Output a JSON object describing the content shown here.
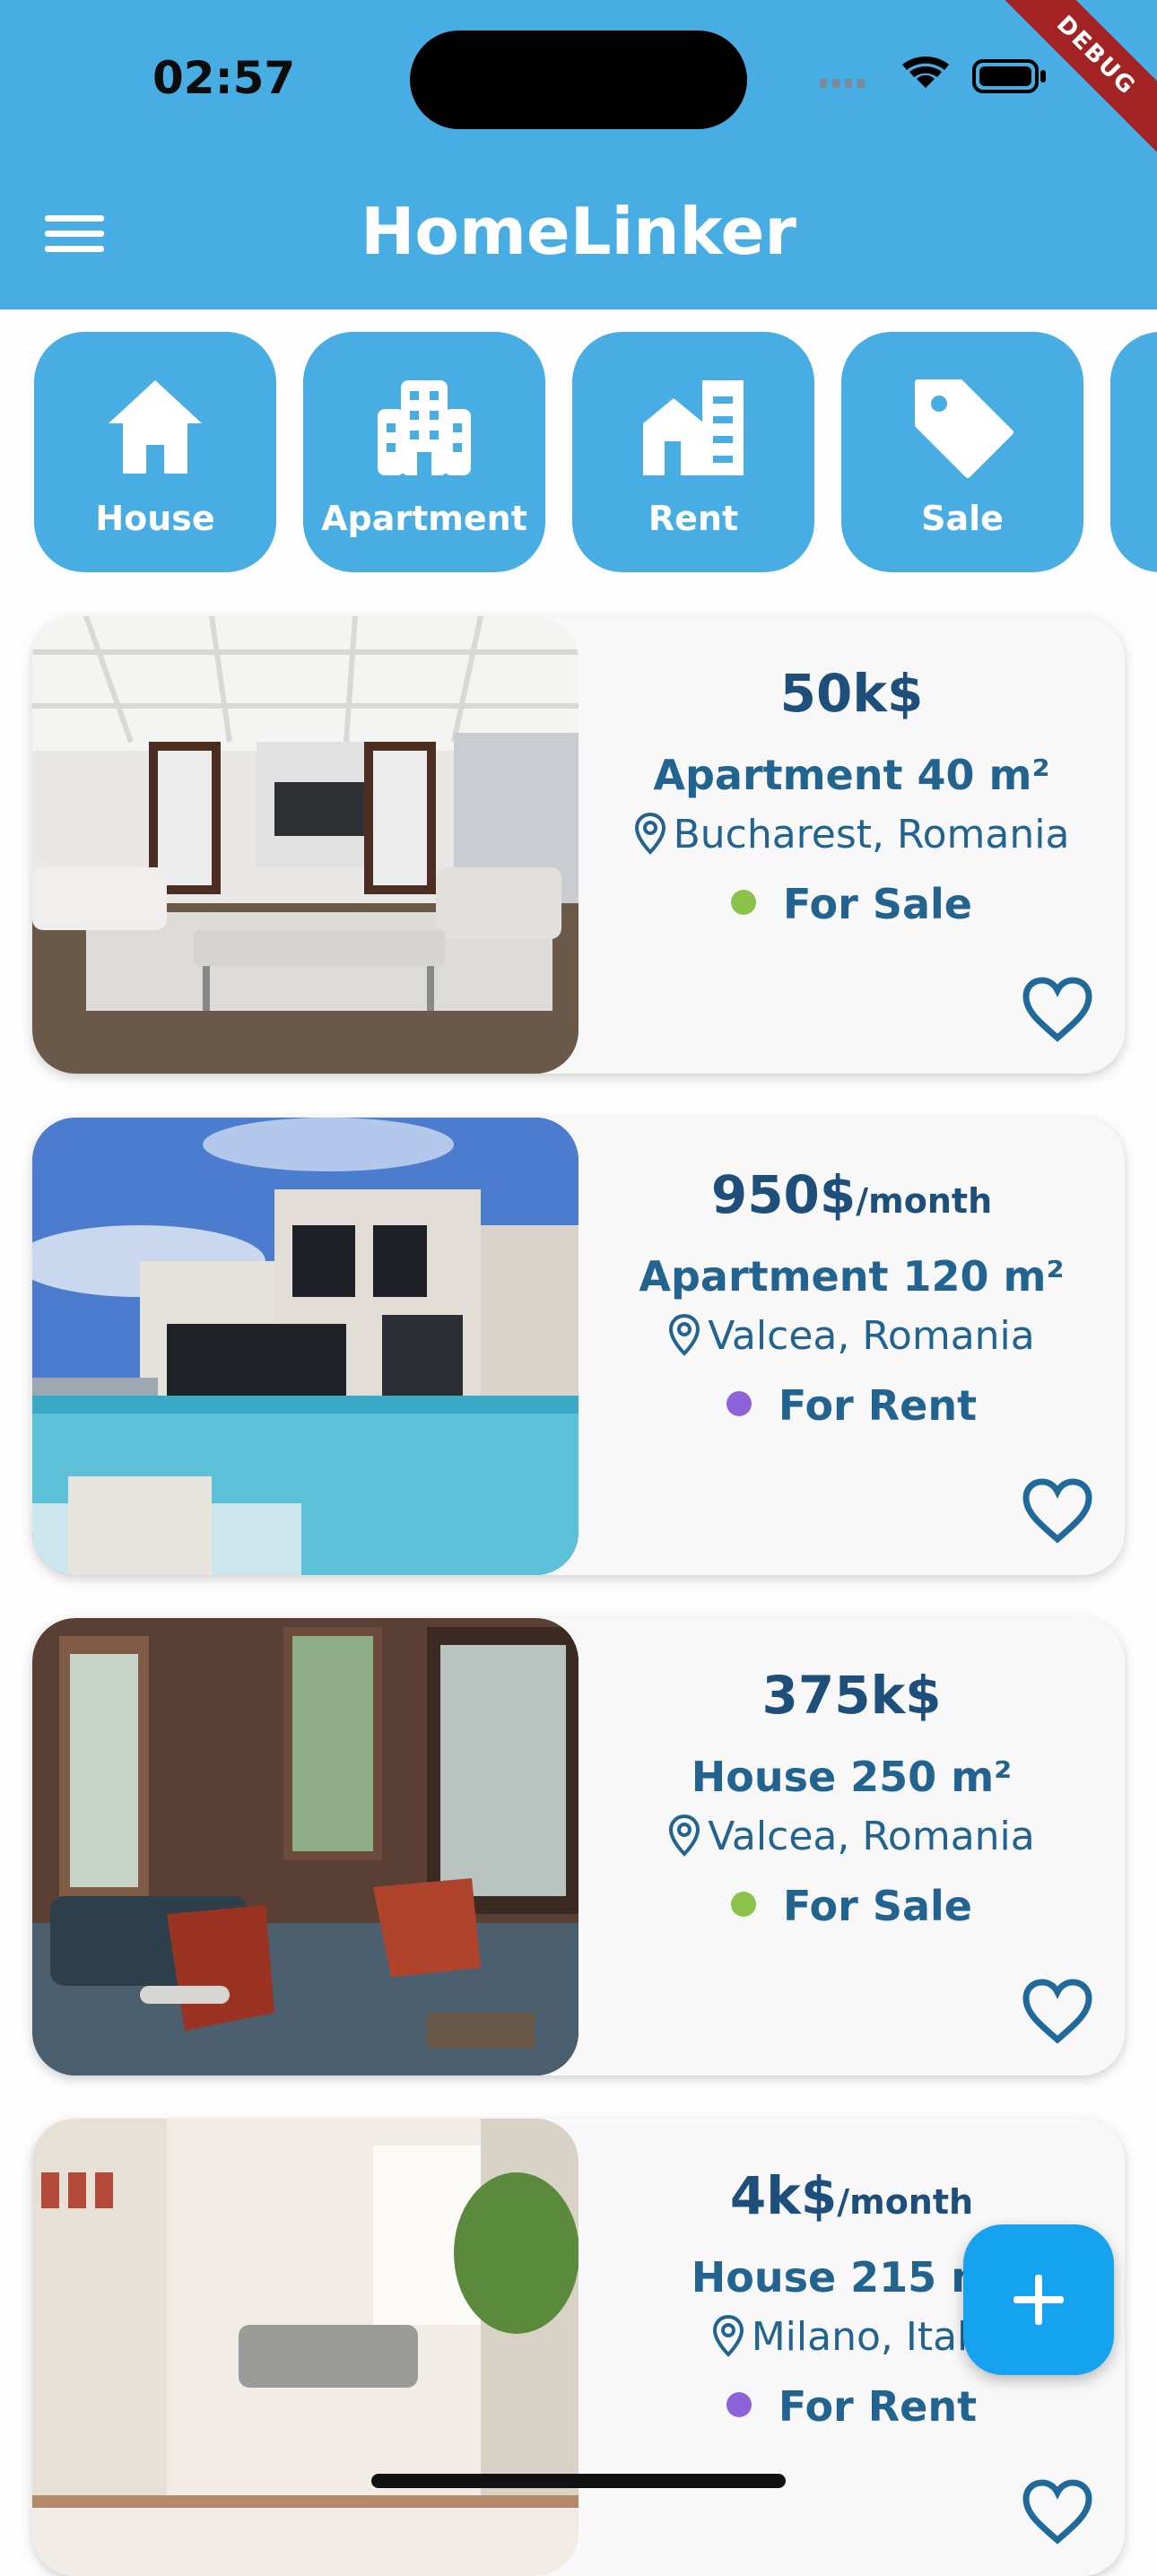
{
  "status_bar": {
    "time": "02:57"
  },
  "debug_banner": "DEBUG",
  "app": {
    "title": "HomeLinker"
  },
  "categories": [
    {
      "label": "House",
      "icon": "house-icon"
    },
    {
      "label": "Apartment",
      "icon": "apartment-building-icon"
    },
    {
      "label": "Rent",
      "icon": "rent-building-icon"
    },
    {
      "label": "Sale",
      "icon": "price-tag-icon"
    }
  ],
  "listings": [
    {
      "price": "50k$",
      "price_unit": "",
      "type": "Apartment 40 m²",
      "location": "Bucharest, Romania",
      "status": "For Sale",
      "status_color": "#8bc34a"
    },
    {
      "price": "950$",
      "price_unit": "/month",
      "type": "Apartment 120 m²",
      "location": "Valcea, Romania",
      "status": "For Rent",
      "status_color": "#8e63d9"
    },
    {
      "price": "375k$",
      "price_unit": "",
      "type": "House 250 m²",
      "location": "Valcea, Romania",
      "status": "For Sale",
      "status_color": "#8bc34a"
    },
    {
      "price": "4k$",
      "price_unit": "/month",
      "type": "House 215 m²",
      "location": "Milano, Italy",
      "status": "For Rent",
      "status_color": "#8e63d9"
    }
  ],
  "colors": {
    "primary": "#47ade3",
    "fab": "#15a3ef",
    "text_dark_blue": "#1d4f7a"
  }
}
